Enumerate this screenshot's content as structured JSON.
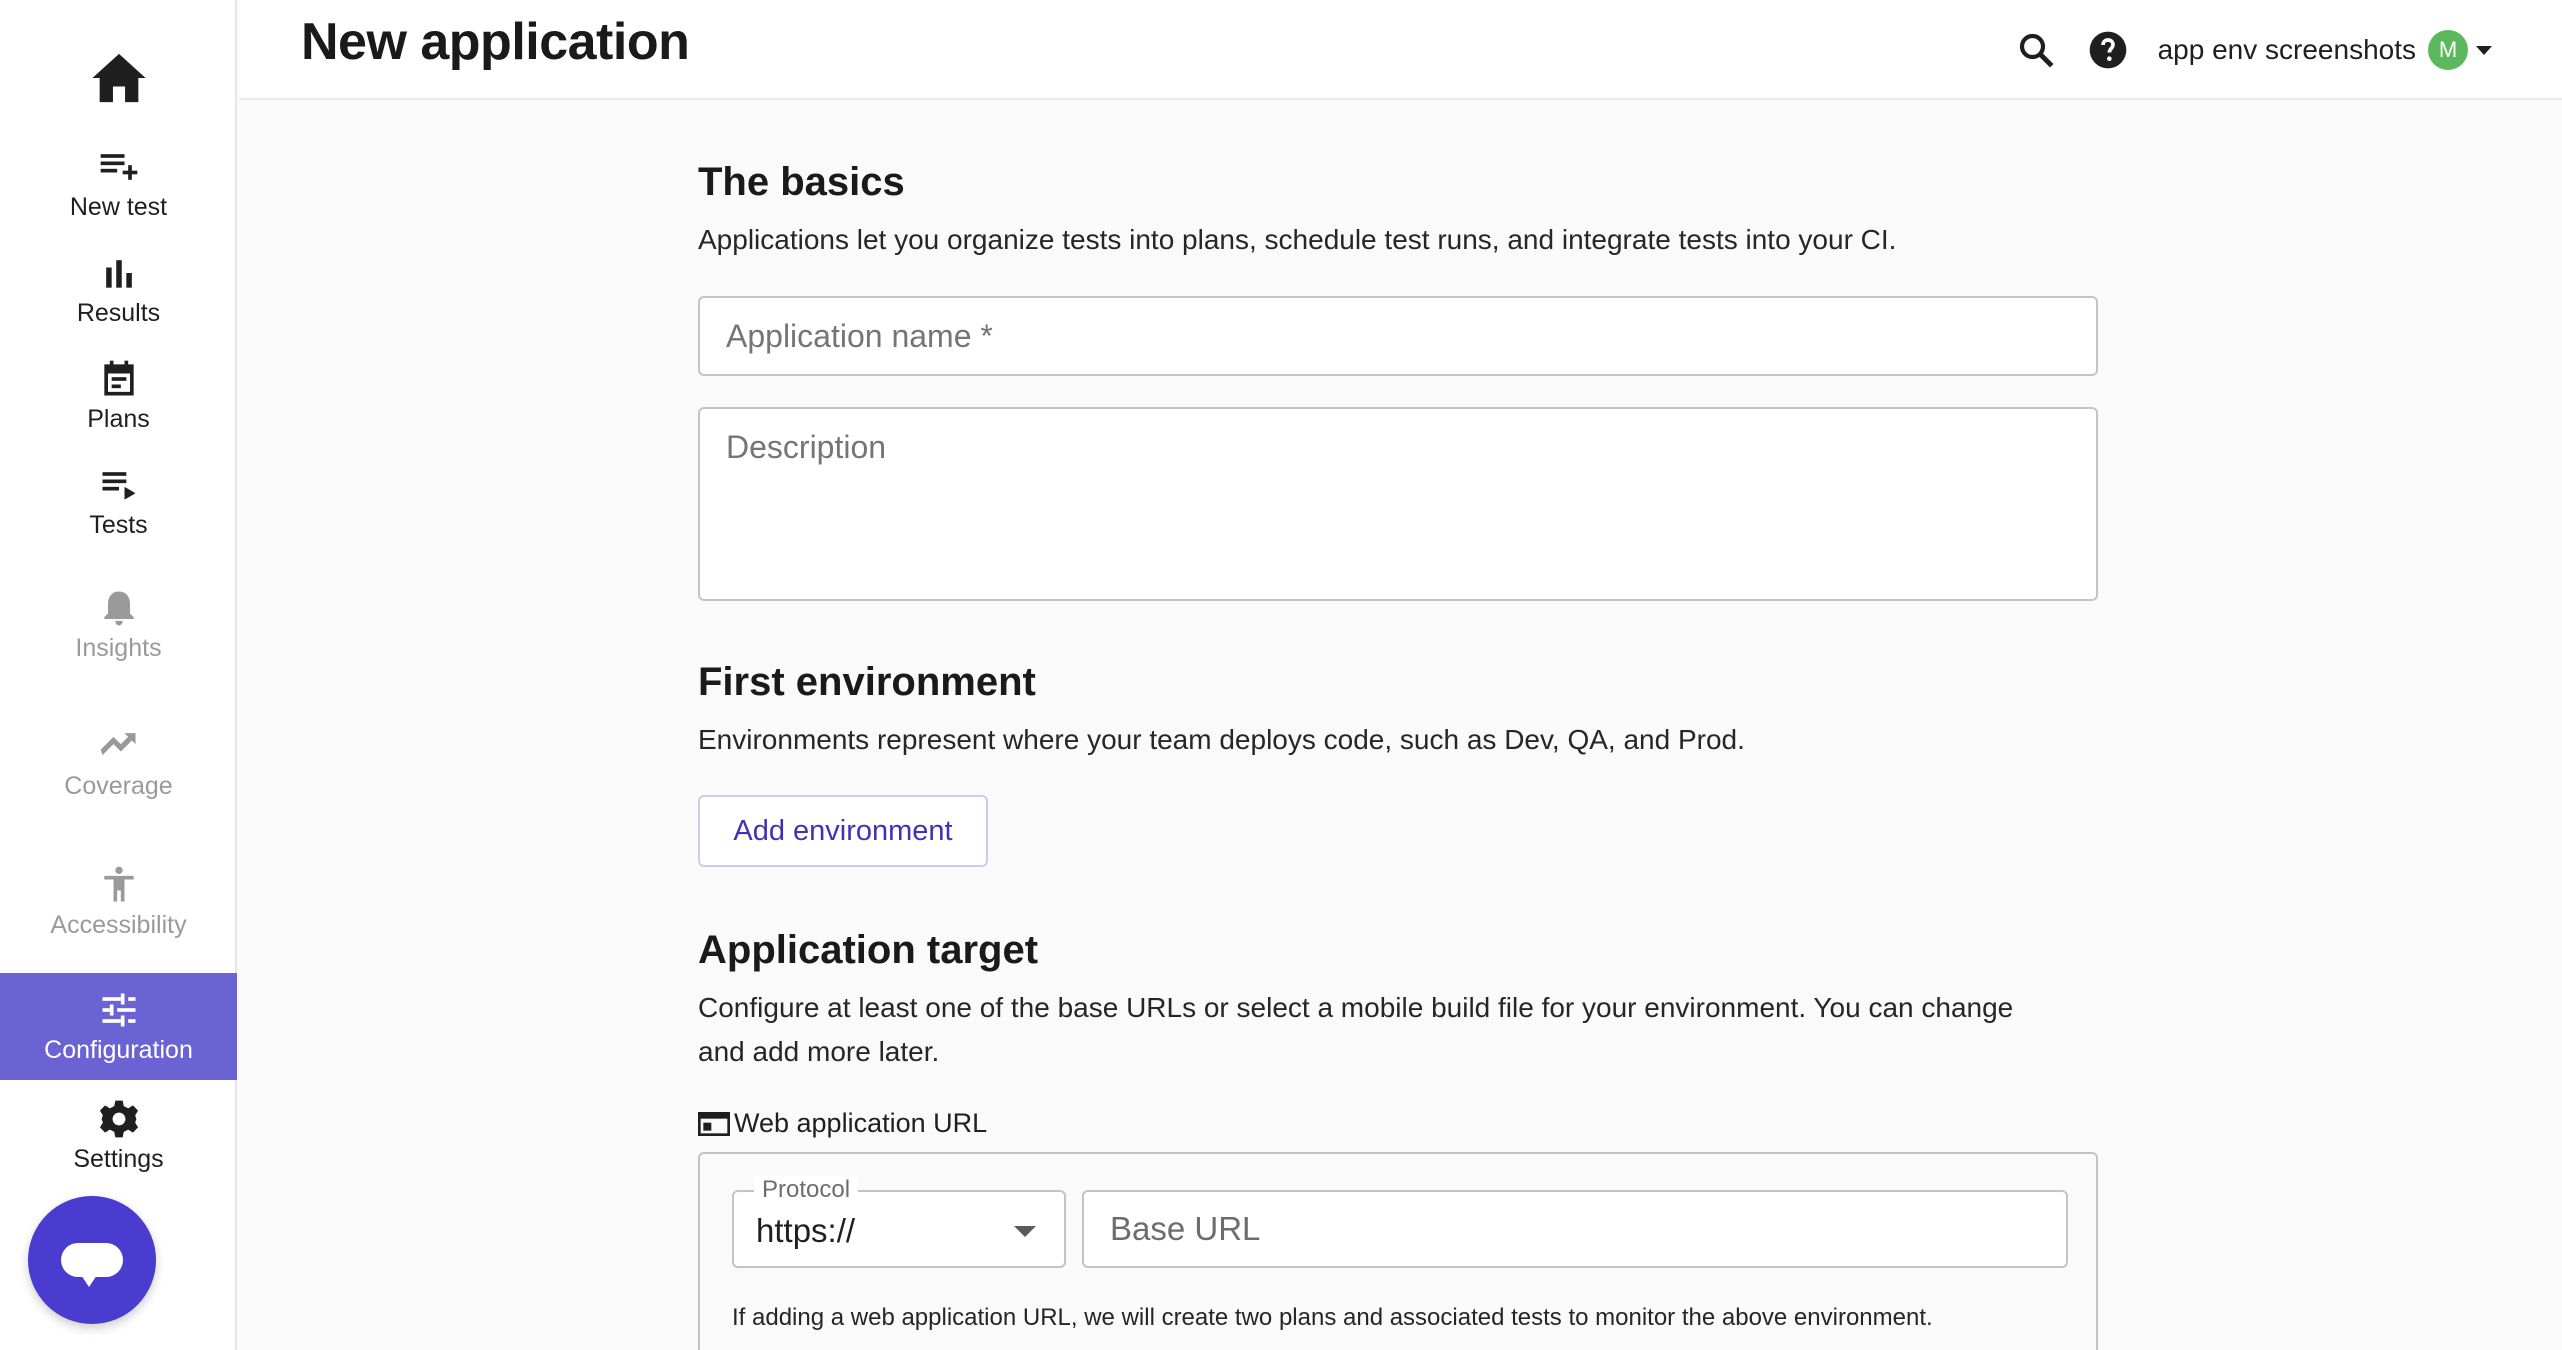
{
  "sidebar": {
    "items": [
      {
        "name": "nav-new-test",
        "label": "New test",
        "icon": "playlist-add-icon",
        "state": "normal"
      },
      {
        "name": "nav-results",
        "label": "Results",
        "icon": "bar-chart-icon",
        "state": "normal"
      },
      {
        "name": "nav-plans",
        "label": "Plans",
        "icon": "calendar-icon",
        "state": "normal"
      },
      {
        "name": "nav-tests",
        "label": "Tests",
        "icon": "playlist-play-icon",
        "state": "normal"
      },
      {
        "name": "nav-insights",
        "label": "Insights",
        "icon": "bell-icon",
        "state": "disabled"
      },
      {
        "name": "nav-coverage",
        "label": "Coverage",
        "icon": "trending-up-icon",
        "state": "disabled"
      },
      {
        "name": "nav-accessibility",
        "label": "Accessibility",
        "icon": "accessibility-icon",
        "state": "disabled"
      },
      {
        "name": "nav-configuration",
        "label": "Configuration",
        "icon": "tune-icon",
        "state": "active"
      },
      {
        "name": "nav-settings",
        "label": "Settings",
        "icon": "gear-icon",
        "state": "normal"
      }
    ],
    "accent_color": "#6b63d3"
  },
  "header": {
    "title": "New application",
    "account_name": "app env screenshots",
    "avatar_initial": "M",
    "avatar_color": "#5cb85c"
  },
  "basics": {
    "title": "The basics",
    "description": "Applications let you organize tests into plans, schedule test runs, and integrate tests into your CI.",
    "name_placeholder": "Application name *",
    "description_placeholder": "Description"
  },
  "environment": {
    "title": "First environment",
    "description": "Environments represent where your team deploys code, such as Dev, QA, and Prod.",
    "add_button": "Add environment"
  },
  "target": {
    "title": "Application target",
    "description_line1": "Configure at least one of the base URLs or select a mobile build file for your environment. You can change",
    "description_line2": "and add more later.",
    "web_label": "Web application URL",
    "protocol_label": "Protocol",
    "protocol_value": "https://",
    "base_url_placeholder": "Base URL",
    "note": "If adding a web application URL, we will create two plans and associated tests to monitor the above environment."
  }
}
